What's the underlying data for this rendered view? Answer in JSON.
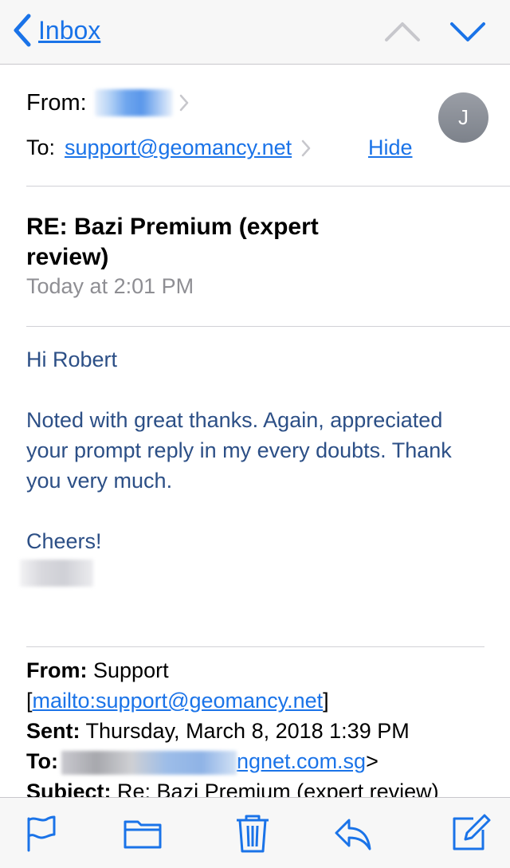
{
  "nav": {
    "back_label": "Inbox",
    "back_icon": "chevron-left-icon",
    "up_icon": "chevron-up-icon",
    "down_icon": "chevron-down-icon",
    "accent": "#1a73e8"
  },
  "header": {
    "from_label": "From:",
    "to_label": "To:",
    "to_email": "support@geomancy.net",
    "hide_label": "Hide",
    "avatar_initial": "J",
    "subject": "RE: Bazi Premium (expert review)",
    "date": "Today at 2:01 PM"
  },
  "body": {
    "greeting": "Hi Robert",
    "paragraph": "Noted with great thanks. Again, appreciated your prompt reply in my every doubts. Thank you very much.",
    "signoff": "Cheers!",
    "text_color": "#2c4f86"
  },
  "quoted": {
    "from_label": "From:",
    "from_value": "Support",
    "bracket_open": "[",
    "mailto": "mailto:support@geomancy.net",
    "bracket_close": "]",
    "sent_label": "Sent:",
    "sent_value": "Thursday, March 8, 2018 1:39 PM",
    "to_label": "To:",
    "to_partial": "ngnet.com.sg",
    "to_suffix": ">",
    "subject_label": "Subject:",
    "subject_value": "Re: Bazi Premium (expert review)"
  },
  "toolbar": {
    "items": [
      "flag-icon",
      "folder-icon",
      "trash-icon",
      "reply-icon",
      "compose-icon"
    ]
  }
}
